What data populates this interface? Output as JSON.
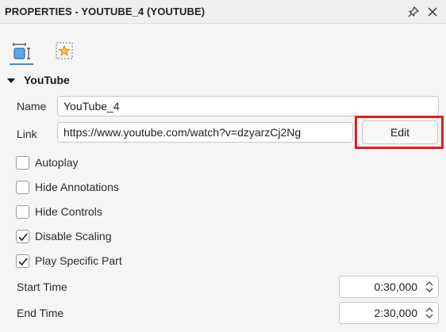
{
  "panel": {
    "title": "PROPERTIES - YOUTUBE_4 (YOUTUBE)"
  },
  "tabs": [
    {
      "icon": "layout-properties-icon",
      "active": true
    },
    {
      "icon": "star-effects-icon",
      "active": false
    }
  ],
  "section": {
    "title": "YouTube"
  },
  "fields": {
    "name_label": "Name",
    "name_value": "YouTube_4",
    "link_label": "Link",
    "link_value": "https://www.youtube.com/watch?v=dzyarzCj2Ng",
    "edit_label": "Edit"
  },
  "options": [
    {
      "label": "Autoplay",
      "checked": false
    },
    {
      "label": "Hide Annotations",
      "checked": false
    },
    {
      "label": "Hide Controls",
      "checked": false
    },
    {
      "label": "Disable Scaling",
      "checked": true
    },
    {
      "label": "Play Specific Part",
      "checked": true
    }
  ],
  "times": {
    "start_label": "Start Time",
    "start_value": "0:30,000",
    "end_label": "End Time",
    "end_value": "2:30,000"
  },
  "colors": {
    "highlight": "#e0201c",
    "accent": "#3a8fd8"
  }
}
